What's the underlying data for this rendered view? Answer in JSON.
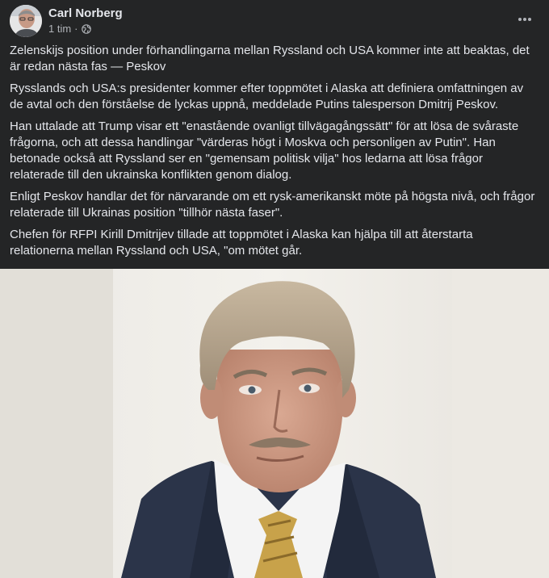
{
  "post": {
    "author": "Carl Norberg",
    "time": "1 tim",
    "separator": "·",
    "audience_icon": "globe-icon",
    "more_icon": "more-options-icon",
    "paragraphs": [
      "Zelenskijs position under förhandlingarna mellan Ryssland och USA kommer inte att beaktas, det är redan nästa fas — Peskov",
      "Rysslands och USA:s presidenter kommer efter toppmötet i Alaska att definiera omfattningen av de avtal och den förståelse de lyckas uppnå, meddelade Putins talesperson Dmitrij Peskov.",
      "Han uttalade att Trump visar ett \"enastående ovanligt tillvägagångssätt\" för att lösa de svåraste frågorna, och att dessa handlingar \"värderas högt i Moskva och personligen av Putin\". Han betonade också att Ryssland ser en \"gemensam politisk vilja\" hos ledarna att lösa frågor relaterade till den ukrainska konflikten genom dialog.",
      "Enligt Peskov handlar det för närvarande om ett rysk-amerikanskt möte på högsta nivå, och frågor relaterade till Ukrainas position \"tillhör nästa faser\".",
      "Chefen för RFPI Kirill Dmitrijev tillade att toppmötet i Alaska kan hjälpa till att återstarta relationerna mellan Ryssland och USA, \"om mötet går."
    ]
  },
  "colors": {
    "background": "#242526",
    "text_primary": "#e4e6eb",
    "text_secondary": "#b0b3b8"
  }
}
